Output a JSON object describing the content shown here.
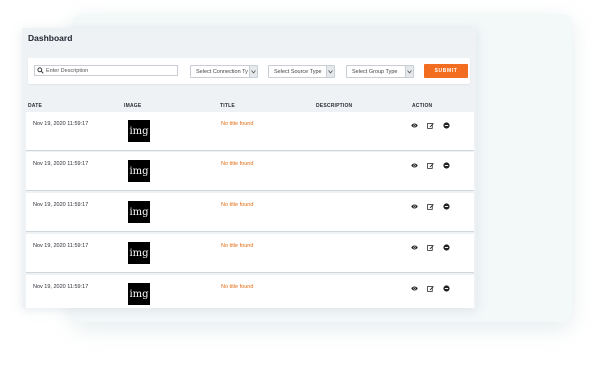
{
  "page": {
    "title": "Dashboard"
  },
  "filters": {
    "search_placeholder": "Enter Description",
    "connection_type_label": "Select Connection Ty",
    "source_type_label": "Select Source Type",
    "group_type_label": "Select Group Type",
    "submit_label": "SUBMIT"
  },
  "table": {
    "headers": [
      "DATE",
      "IMAGE",
      "TITLE",
      "DESCRIPTION",
      "ACTION"
    ],
    "rows": [
      {
        "date": "Nov 19, 2020 11:59:17",
        "image_text": "img",
        "title": "No title found",
        "description": ""
      },
      {
        "date": "Nov 19, 2020 11:59:17",
        "image_text": "img",
        "title": "No title found",
        "description": ""
      },
      {
        "date": "Nov 19, 2020 11:59:17",
        "image_text": "img",
        "title": "No title found",
        "description": ""
      },
      {
        "date": "Nov 19, 2020 11:59:17",
        "image_text": "img",
        "title": "No title found",
        "description": ""
      },
      {
        "date": "Nov 19, 2020 11:59:17",
        "image_text": "img",
        "title": "No title found",
        "description": ""
      }
    ],
    "row_actions": [
      "eye-icon",
      "edit-icon",
      "delete-icon"
    ]
  },
  "colors": {
    "accent": "#f26d1f",
    "title_text": "#e26b12",
    "panel_bg": "#eef2f5",
    "back_card_bg": "#f3f8f9"
  }
}
